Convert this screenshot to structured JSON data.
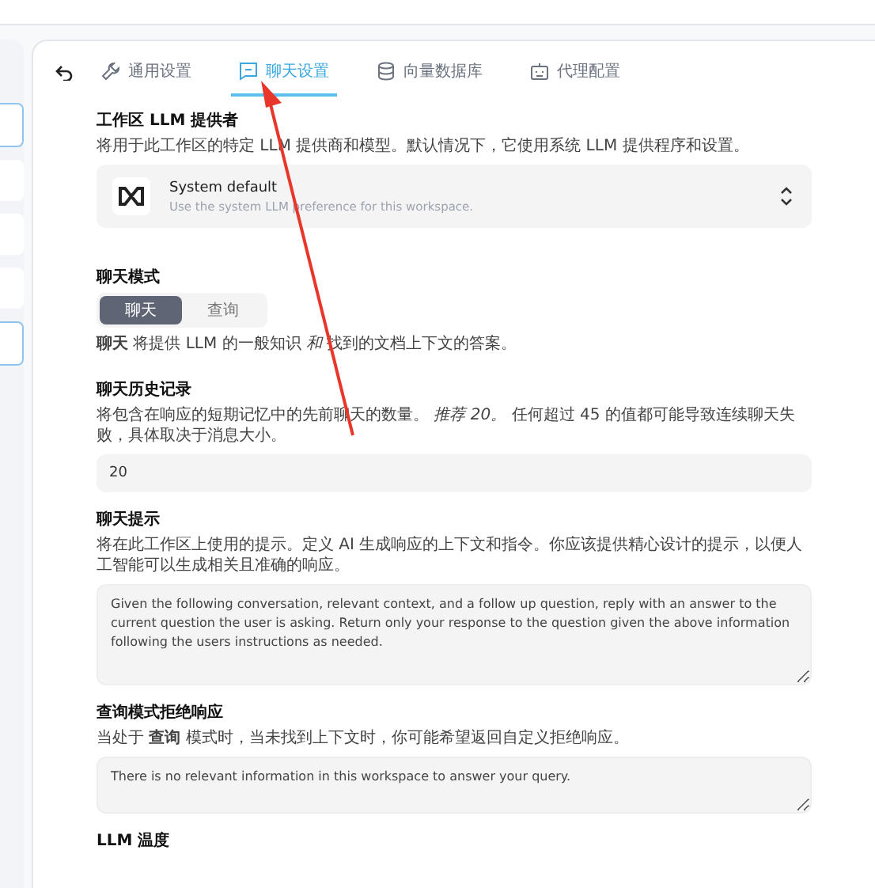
{
  "tabs": [
    {
      "label": "通用设置",
      "selected": false
    },
    {
      "label": "聊天设置",
      "selected": true
    },
    {
      "label": "向量数据库",
      "selected": false
    },
    {
      "label": "代理配置",
      "selected": false
    }
  ],
  "provider": {
    "title": "工作区 LLM 提供者",
    "description": "将用于此工作区的特定 LLM 提供商和模型。默认情况下，它使用系统 LLM 提供程序和设置。",
    "name": "System default",
    "subtitle": "Use the system LLM preference for this workspace."
  },
  "chat_mode": {
    "title": "聊天模式",
    "options": [
      {
        "label": "聊天",
        "selected": true
      },
      {
        "label": "查询",
        "selected": false
      }
    ],
    "description": "**聊天** 将提供 LLM 的一般知识 *和* 找到的文档上下文的答案。"
  },
  "history": {
    "title": "聊天历史记录",
    "description": "将包含在响应的短期记忆中的先前聊天的数量。 *推荐 20。* 任何超过 45 的值都可能导致连续聊天失败，具体取决于消息大小。",
    "value": "20"
  },
  "prompt": {
    "title": "聊天提示",
    "description": "将在此工作区上使用的提示。定义 AI 生成响应的上下文和指令。你应该提供精心设计的提示，以便人工智能可以生成相关且准确的响应。",
    "value": "Given the following conversation, relevant context, and a follow up question, reply with an answer to the current question the user is asking. Return only your response to the question given the above information following the users instructions as needed."
  },
  "refusal": {
    "title": "查询模式拒绝响应",
    "description": "当处于 **查询** 模式时，当未找到上下文时，你可能希望返回自定义拒绝响应。",
    "value": "There is no relevant information in this workspace to answer your query."
  },
  "next_section": {
    "title": "LLM 温度"
  }
}
